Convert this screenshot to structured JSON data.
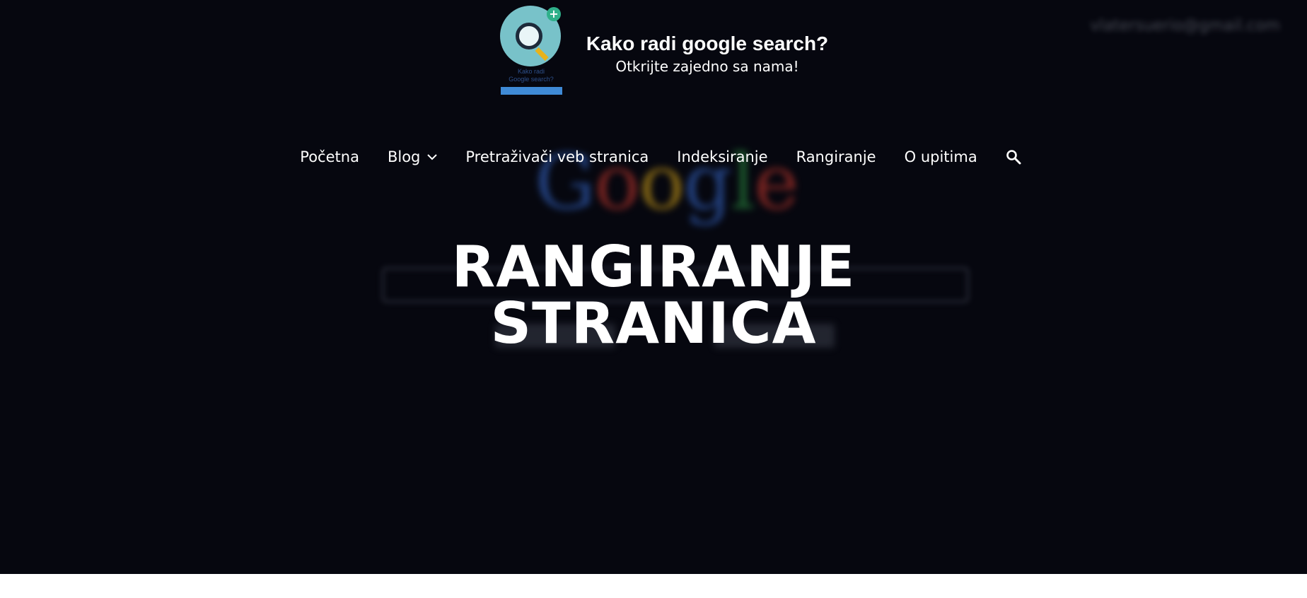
{
  "site": {
    "title": "Kako radi google search?",
    "tagline": "Otkrijte zajedno sa nama!",
    "logo_text_line1": "Kako radi",
    "logo_text_line2": "Google search?"
  },
  "nav": {
    "items": [
      {
        "label": "Početna"
      },
      {
        "label": "Blog",
        "has_dropdown": true
      },
      {
        "label": "Pretraživači veb stranica"
      },
      {
        "label": "Indeksiranje"
      },
      {
        "label": "Rangiranje"
      },
      {
        "label": "O upitima"
      }
    ],
    "search_icon": "search-icon"
  },
  "hero": {
    "title_line1": "RANGIRANJE",
    "title_line2": "STRANICA",
    "background_text": "Google",
    "background_email": "vlatersuerio@gmail.com"
  },
  "colors": {
    "hero_bg": "#06070f",
    "text": "#ffffff",
    "logo_circle": "#78c2c9",
    "logo_bar": "#3f8ad6"
  }
}
